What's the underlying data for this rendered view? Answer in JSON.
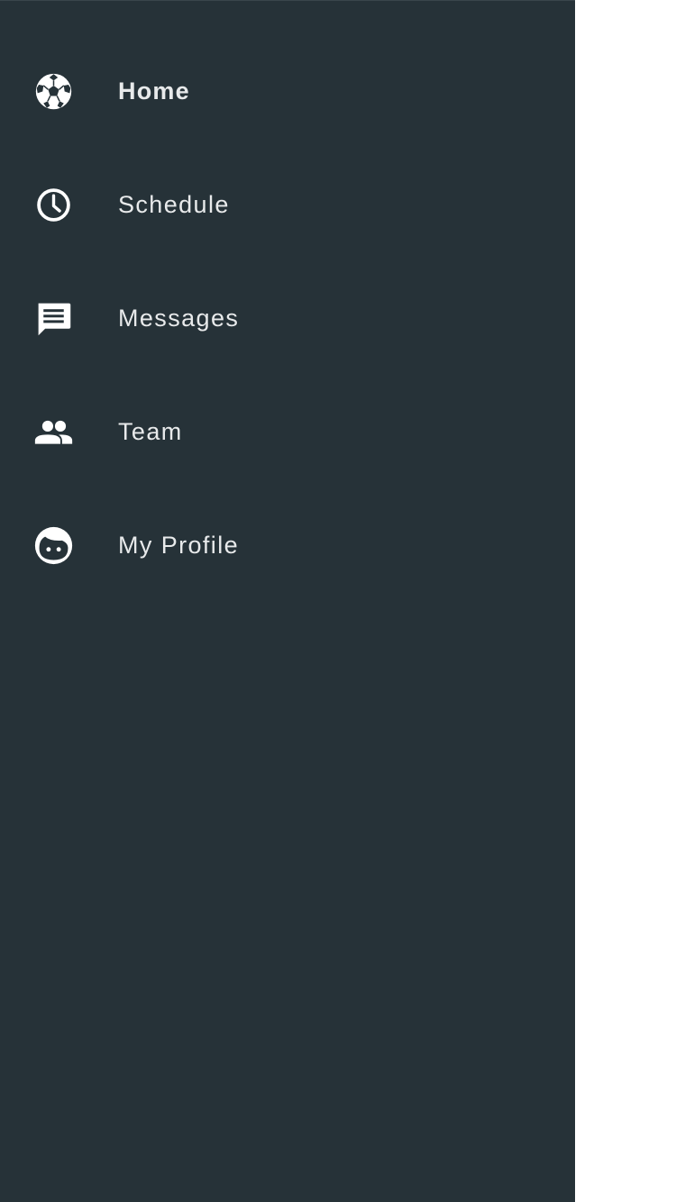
{
  "drawer": {
    "background": "#263238",
    "text_color": "#e8eaeb",
    "items": [
      {
        "label": "Home",
        "icon": "soccer-ball-icon",
        "active": true
      },
      {
        "label": "Schedule",
        "icon": "clock-icon",
        "active": false
      },
      {
        "label": "Messages",
        "icon": "message-icon",
        "active": false
      },
      {
        "label": "Team",
        "icon": "people-icon",
        "active": false
      },
      {
        "label": "My Profile",
        "icon": "face-icon",
        "active": false
      }
    ]
  }
}
